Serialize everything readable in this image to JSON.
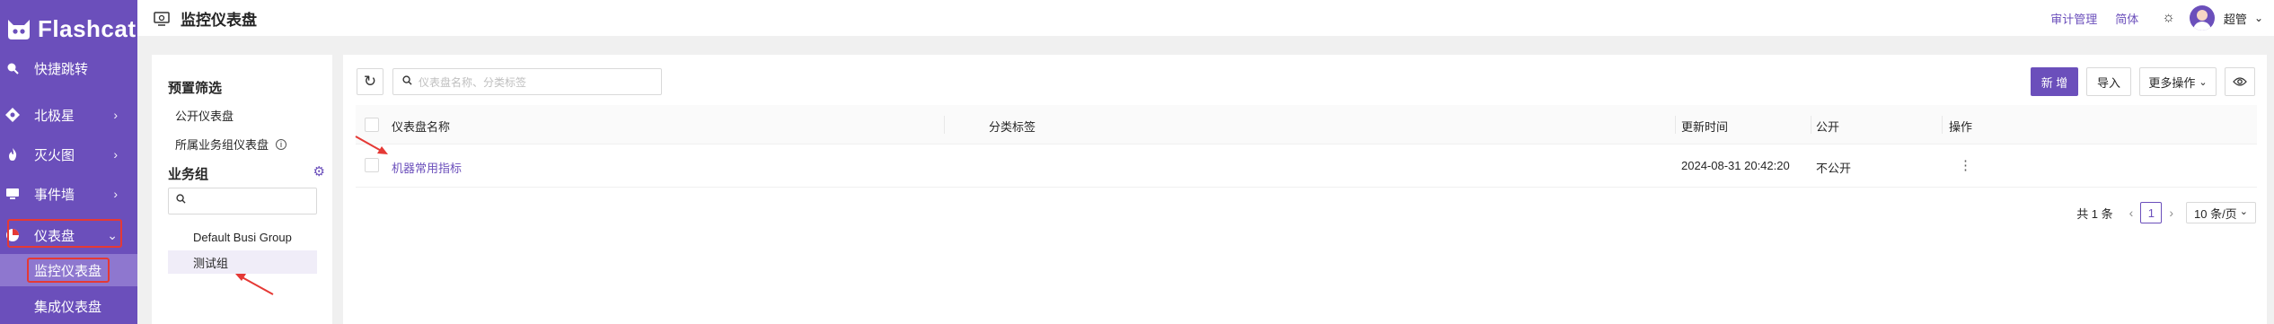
{
  "brand": {
    "name": "Flashcat"
  },
  "sidebar": {
    "items": [
      {
        "label": "快捷跳转",
        "icon": "search-icon"
      },
      {
        "label": "北极星",
        "icon": "star-icon"
      },
      {
        "label": "灭火图",
        "icon": "fire-icon"
      },
      {
        "label": "事件墙",
        "icon": "monitor-icon"
      },
      {
        "label": "仪表盘",
        "icon": "dashboard-icon"
      }
    ],
    "sub_items": [
      {
        "label": "监控仪表盘"
      },
      {
        "label": "集成仪表盘"
      }
    ]
  },
  "header": {
    "title": "监控仪表盘",
    "audit_link": "审计管理",
    "language_link": "简体",
    "user_name": "超管"
  },
  "filter": {
    "preset_title": "预置筛选",
    "preset_items": [
      "公开仪表盘",
      "所属业务组仪表盘"
    ],
    "group_title": "业务组",
    "search_placeholder": "",
    "groups": [
      "Default Busi Group",
      "测试组"
    ]
  },
  "toolbar": {
    "search_placeholder": "仪表盘名称、分类标签",
    "new_label": "新 增",
    "import_label": "导入",
    "more_label": "更多操作"
  },
  "table": {
    "columns": [
      "仪表盘名称",
      "分类标签",
      "更新时间",
      "公开",
      "操作"
    ],
    "rows": [
      {
        "name": "机器常用指标",
        "tags": "",
        "updated": "2024-08-31 20:42:20",
        "public": "不公开"
      }
    ]
  },
  "pagination": {
    "total": "共 1 条",
    "current_page": "1",
    "page_size": "10 条/页"
  },
  "colors": {
    "brand": "#6b4fbb",
    "annotation": "#e53935"
  }
}
